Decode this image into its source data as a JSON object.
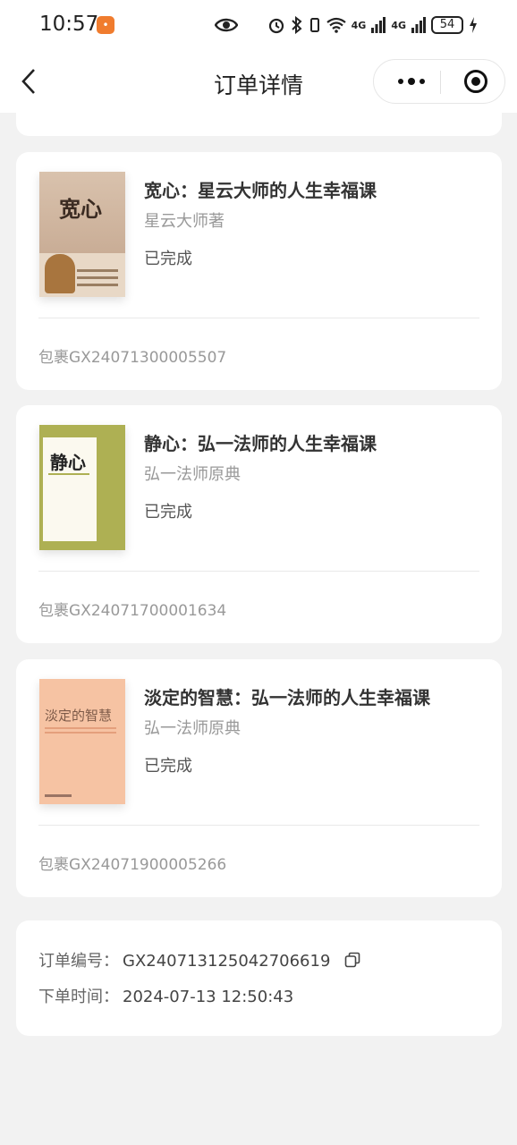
{
  "status_bar": {
    "time": "10:57",
    "signal_1": "4G",
    "signal_2": "4G",
    "battery": "54"
  },
  "nav": {
    "title": "订单详情"
  },
  "books": [
    {
      "title": "宽心：星云大师的人生幸福课",
      "author": "星云大师著",
      "status": "已完成",
      "package": "包裹GX24071300005507",
      "cover_text": "宽心"
    },
    {
      "title": "静心：弘一法师的人生幸福课",
      "author": "弘一法师原典",
      "status": "已完成",
      "package": "包裹GX24071700001634",
      "cover_text": "静心"
    },
    {
      "title": "淡定的智慧：弘一法师的人生幸福课",
      "author": "弘一法师原典",
      "status": "已完成",
      "package": "包裹GX24071900005266",
      "cover_text": "淡定的智慧"
    }
  ],
  "order_info": {
    "order_no_label": "订单编号：",
    "order_no": "GX240713125042706619",
    "order_time_label": "下单时间：",
    "order_time": "2024-07-13 12:50:43"
  },
  "colors": {
    "background": "#f2f2f2",
    "card": "#ffffff",
    "text_primary": "#333333",
    "text_secondary": "#999999"
  }
}
